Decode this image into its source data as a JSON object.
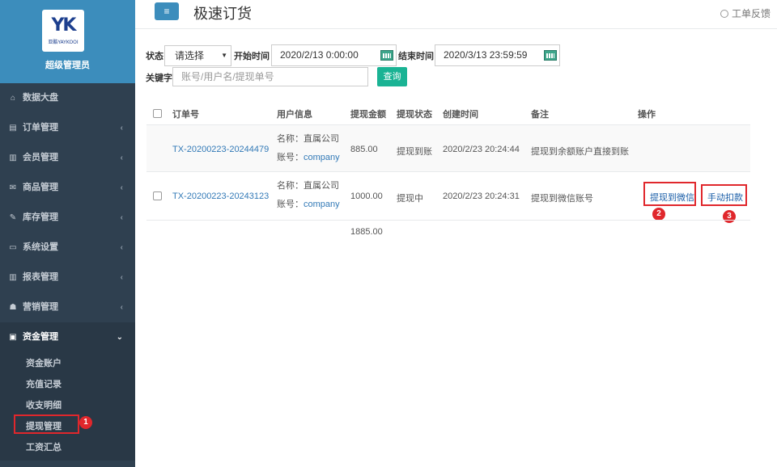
{
  "brand": {
    "logo_mark": "YK",
    "logo_sub": "亚酷YAYKOOI",
    "role": "超级管理员"
  },
  "sidebar": {
    "items": [
      {
        "icon": "⌂",
        "label": "数据大盘",
        "chevron": ""
      },
      {
        "icon": "▤",
        "label": "订单管理",
        "chevron": "‹"
      },
      {
        "icon": "▥",
        "label": "会员管理",
        "chevron": "‹"
      },
      {
        "icon": "✉",
        "label": "商品管理",
        "chevron": "‹"
      },
      {
        "icon": "✎",
        "label": "库存管理",
        "chevron": "‹"
      },
      {
        "icon": "▭",
        "label": "系统设置",
        "chevron": "‹"
      },
      {
        "icon": "▥",
        "label": "报表管理",
        "chevron": "‹"
      },
      {
        "icon": "☗",
        "label": "营销管理",
        "chevron": "‹"
      },
      {
        "icon": "▣",
        "label": "资金管理",
        "chevron": "⌄"
      }
    ],
    "sub_items": [
      "资金账户",
      "充值记录",
      "收支明细",
      "提现管理",
      "工资汇总"
    ]
  },
  "header": {
    "title": "极速订货",
    "feedback": "工单反馈",
    "menu_icon": "≡"
  },
  "filters": {
    "status_label": "状态",
    "status_value": "请选择",
    "start_label": "开始时间",
    "start_value": "2020/2/13 0:00:00",
    "end_label": "结束时间",
    "end_value": "2020/3/13 23:59:59",
    "keyword_label": "关键字",
    "keyword_placeholder": "账号/用户名/提现单号",
    "search_button": "查询"
  },
  "table": {
    "headers": [
      "订单号",
      "用户信息",
      "提现金额",
      "提现状态",
      "创建时间",
      "备注",
      "操作"
    ],
    "name_prefix": "名称：",
    "account_prefix": "账号：",
    "rows": [
      {
        "order": "TX-20200223-20244479",
        "name": "直属公司",
        "account": "company",
        "amount": "885.00",
        "status": "提现到账",
        "created": "2020/2/23 20:24:44",
        "remark": "提现到余额账户直接到账"
      },
      {
        "order": "TX-20200223-20243123",
        "name": "直属公司",
        "account": "company",
        "amount": "1000.00",
        "status": "提现中",
        "created": "2020/2/23 20:24:31",
        "remark": "提现到微信账号",
        "action1": "提现到微信",
        "action2": "手动扣款"
      }
    ],
    "total": "1885.00"
  },
  "badges": [
    "1",
    "2",
    "3"
  ],
  "colors": {
    "sidebar_bg": "#2f4050",
    "brand_bg": "#3c8dbc",
    "highlight": "#e0272c",
    "search_button": "#1ab394",
    "link": "#337ab7"
  }
}
